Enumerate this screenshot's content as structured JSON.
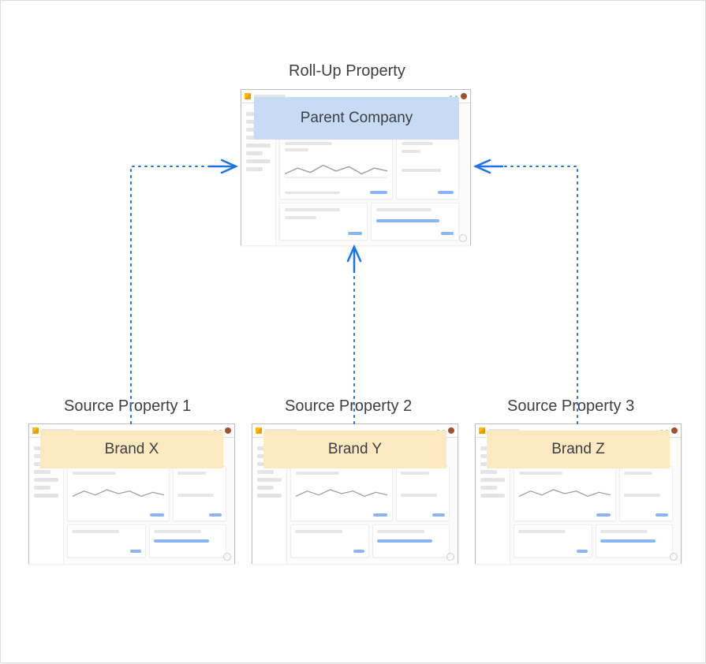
{
  "title": "Roll-Up Property",
  "parent": {
    "badge": "Parent Company"
  },
  "sources": [
    {
      "caption": "Source Property 1",
      "badge": "Brand  X"
    },
    {
      "caption": "Source Property 2",
      "badge": "Brand Y"
    },
    {
      "caption": "Source Property 3",
      "badge": "Brand Z"
    }
  ],
  "colors": {
    "connector": "#1a73e8",
    "parentBadgeBg": "#c7dbf5",
    "sourceBadgeBg": "#fde9c1"
  }
}
